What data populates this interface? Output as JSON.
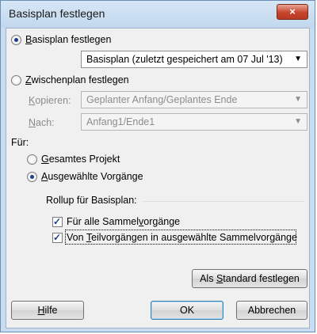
{
  "window": {
    "title": "Basisplan festlegen",
    "close_symbol": "×"
  },
  "baseline_option": {
    "label_prefix": "",
    "label_accel": "B",
    "label_rest": "asisplan festlegen",
    "selected": true,
    "dropdown_value": "Basisplan (zuletzt gespeichert am 07 Jul '13)"
  },
  "interim_option": {
    "label_accel": "Z",
    "label_rest": "wischenplan festlegen",
    "selected": false,
    "copy_label_accel": "K",
    "copy_label_rest": "opieren:",
    "copy_value": "Geplanter Anfang/Geplantes Ende",
    "into_label_accel": "N",
    "into_label_rest": "ach:",
    "into_value": "Anfang1/Ende1"
  },
  "for_section": {
    "label": "Für:",
    "entire_project_accel": "G",
    "entire_project_rest": "esamtes Projekt",
    "entire_project_selected": false,
    "selected_tasks_accel": "A",
    "selected_tasks_rest": "usgewählte Vorgänge",
    "selected_tasks_selected": true
  },
  "rollup": {
    "label": "Rollup für Basisplan:",
    "option1_before": "Für alle Sammel",
    "option1_accel": "v",
    "option1_after": "orgänge",
    "option1_checked": true,
    "option2_before": "Von ",
    "option2_accel": "T",
    "option2_after": "eilvorgängen in ausgewählte Sammelvorgänge",
    "option2_checked": true
  },
  "buttons": {
    "set_default_before": "Als ",
    "set_default_accel": "S",
    "set_default_after": "tandard festlegen",
    "help_accel": "H",
    "help_rest": "ilfe",
    "ok": "OK",
    "cancel": "Abbrechen"
  },
  "icons": {
    "dropdown": "chevron-down-icon",
    "checkmark": "check-icon",
    "close": "close-icon"
  },
  "colors": {
    "title_bar": "#c9dcf0",
    "close_button": "#c7432c",
    "dialog_bg": "#f0f0f0",
    "radio_check": "#1b3d8a"
  }
}
